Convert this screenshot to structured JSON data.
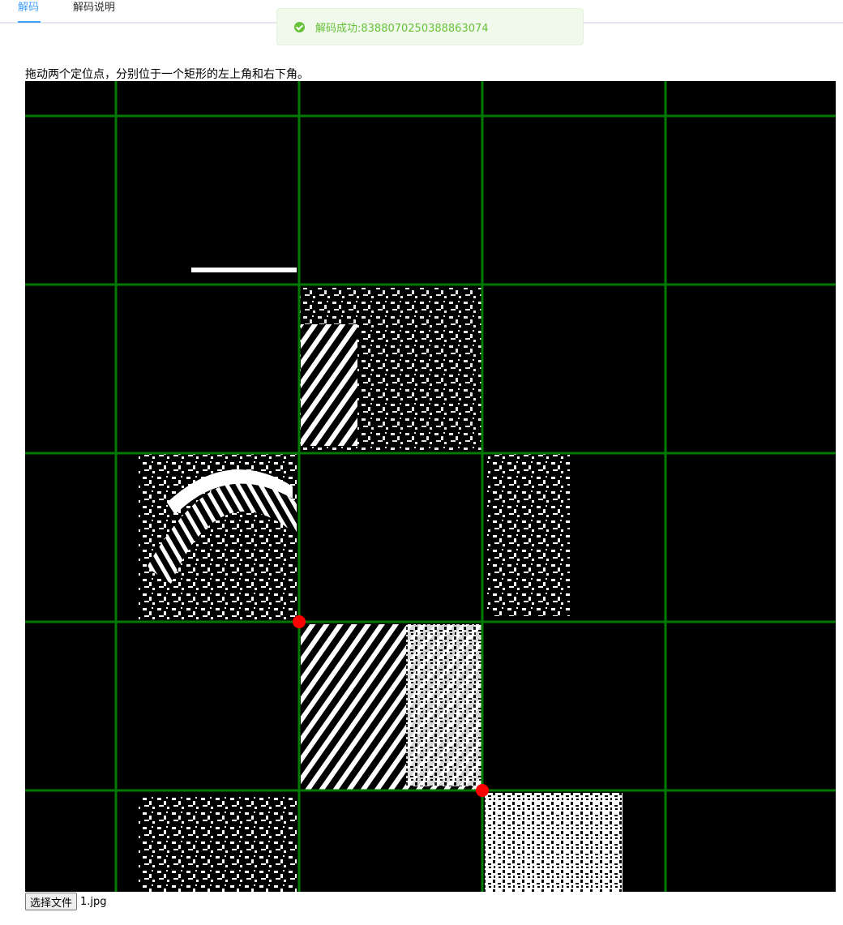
{
  "tabs": [
    {
      "label": "解码",
      "active": true
    },
    {
      "label": "解码说明",
      "active": false
    }
  ],
  "toast": {
    "type": "success",
    "message": "解码成功:8388070250388863074",
    "color": "#67c23a",
    "icon": "check-circle-icon"
  },
  "instruction": "拖动两个定位点，分别位于一个矩形的左上角和右下角。",
  "canvas": {
    "background": "#000000",
    "grid_color": "#007a00",
    "handle_color": "#ff0000",
    "handles": [
      "top-left-handle",
      "bottom-right-handle"
    ]
  },
  "file_input": {
    "button_label": "选择文件",
    "file_name": "1.jpg"
  }
}
